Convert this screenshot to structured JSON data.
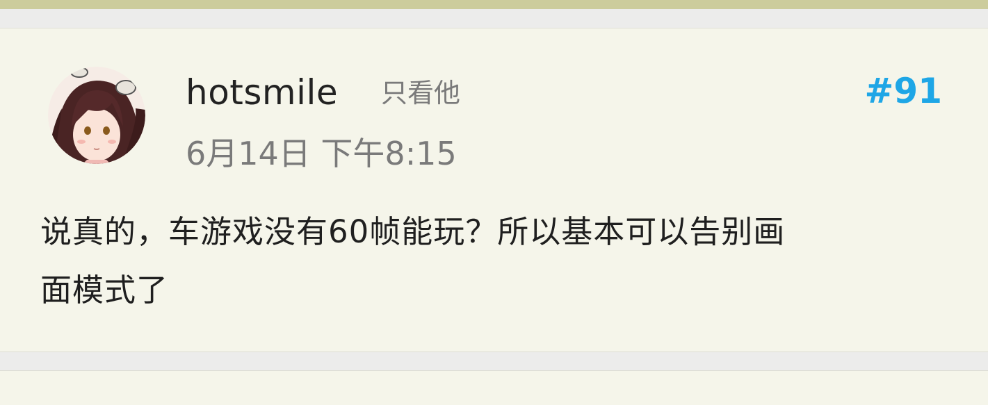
{
  "post": {
    "username": "hotsmile",
    "only_him_label": "只看他",
    "floor": "#91",
    "timestamp": "6月14日 下午8:15",
    "content": "说真的，车游戏没有60帧能玩？所以基本可以告别画\n面模式了"
  },
  "colors": {
    "accent": "#1ea6e6",
    "card_background": "#f5f5ea",
    "top_bar": "#cccc9c"
  }
}
